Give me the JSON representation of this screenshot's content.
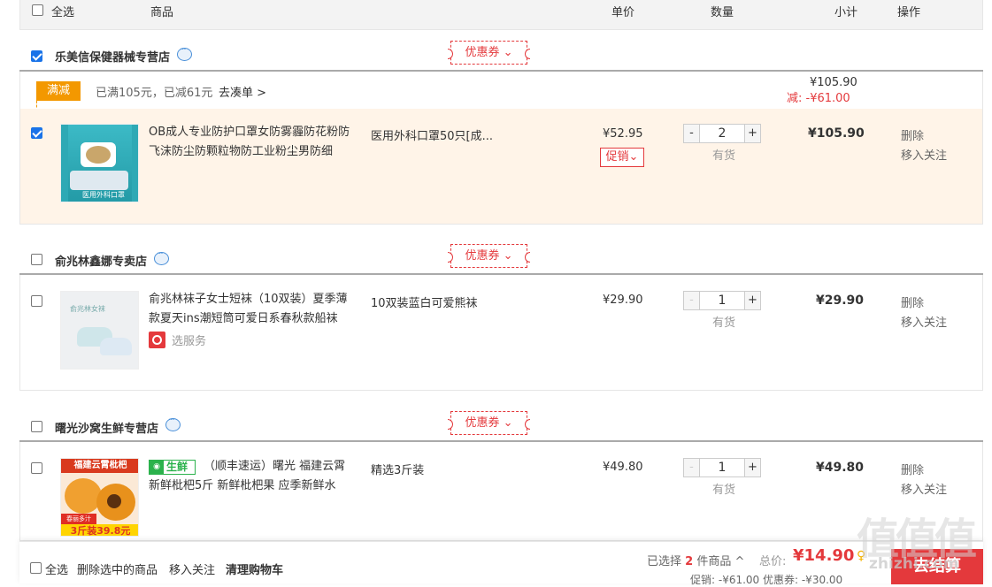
{
  "header": {
    "select_all": "全选",
    "product": "商品",
    "unit_price": "单价",
    "quantity": "数量",
    "subtotal": "小计",
    "action": "操作"
  },
  "shops": [
    {
      "name": "乐美信保健器械专营店",
      "checked": true,
      "coupon_label": "优惠券",
      "promo": {
        "tag": "满减",
        "text": "已满105元，已减61元",
        "link": "去凑单 >",
        "total": "¥105.90",
        "discount": "减: -¥61.00"
      },
      "items": [
        {
          "checked": true,
          "title": "OB成人专业防护口罩女防雾霾防花粉防飞沫防尘防颗粒物防工业粉尘男防细",
          "spec": "医用外科口罩50只[成...",
          "price": "¥52.95",
          "promo_tag": "促销",
          "qty": "2",
          "stock": "有货",
          "subtotal": "¥105.90",
          "delete": "删除",
          "follow": "移入关注",
          "image_text": "医用外科口罩"
        }
      ]
    },
    {
      "name": "俞兆林鑫娜专卖店",
      "checked": false,
      "coupon_label": "优惠券",
      "items": [
        {
          "checked": false,
          "title": "俞兆林袜子女士短袜（10双装）夏季薄款夏天ins潮短筒可爱日系春秋款船袜",
          "service": "选服务",
          "spec": "10双装蓝白可爱熊袜",
          "price": "¥29.90",
          "qty": "1",
          "stock": "有货",
          "subtotal": "¥29.90",
          "delete": "删除",
          "follow": "移入关注",
          "image_text": "俞兆林女袜"
        }
      ]
    },
    {
      "name": "曙光沙窝生鲜专营店",
      "checked": false,
      "coupon_label": "优惠券",
      "items": [
        {
          "checked": false,
          "fresh_tag": "生鲜",
          "title": "（顺丰速运）曙光 福建云霄新鲜枇杷5斤 新鲜枇杷果 应季新鲜水",
          "spec": "精选3斤装",
          "price": "¥49.80",
          "qty": "1",
          "stock": "有货",
          "subtotal": "¥49.80",
          "delete": "删除",
          "follow": "移入关注",
          "image_banner": "福建云霄枇杷",
          "image_badge": "春丽多汁",
          "image_price": "3斤装39.8元"
        }
      ]
    }
  ],
  "footer": {
    "select_all": "全选",
    "delete_selected": "删除选中的商品",
    "move_follow": "移入关注",
    "clear_cart": "清理购物车",
    "selected_prefix": "已选择",
    "selected_count": "2",
    "selected_suffix": "件商品",
    "total_label": "总价:",
    "total": "¥14.90",
    "promo_line": "促销: -¥61.00 优惠券: -¥30.00",
    "checkout": "去结算"
  },
  "watermark": {
    "big": "值值值",
    "url": "zhizhi.com"
  },
  "colors": {
    "accent_red": "#e4393c",
    "selected_bg": "#fff4e8",
    "mj_orange": "#f39800",
    "checkbox_blue": "#1a73e8"
  }
}
